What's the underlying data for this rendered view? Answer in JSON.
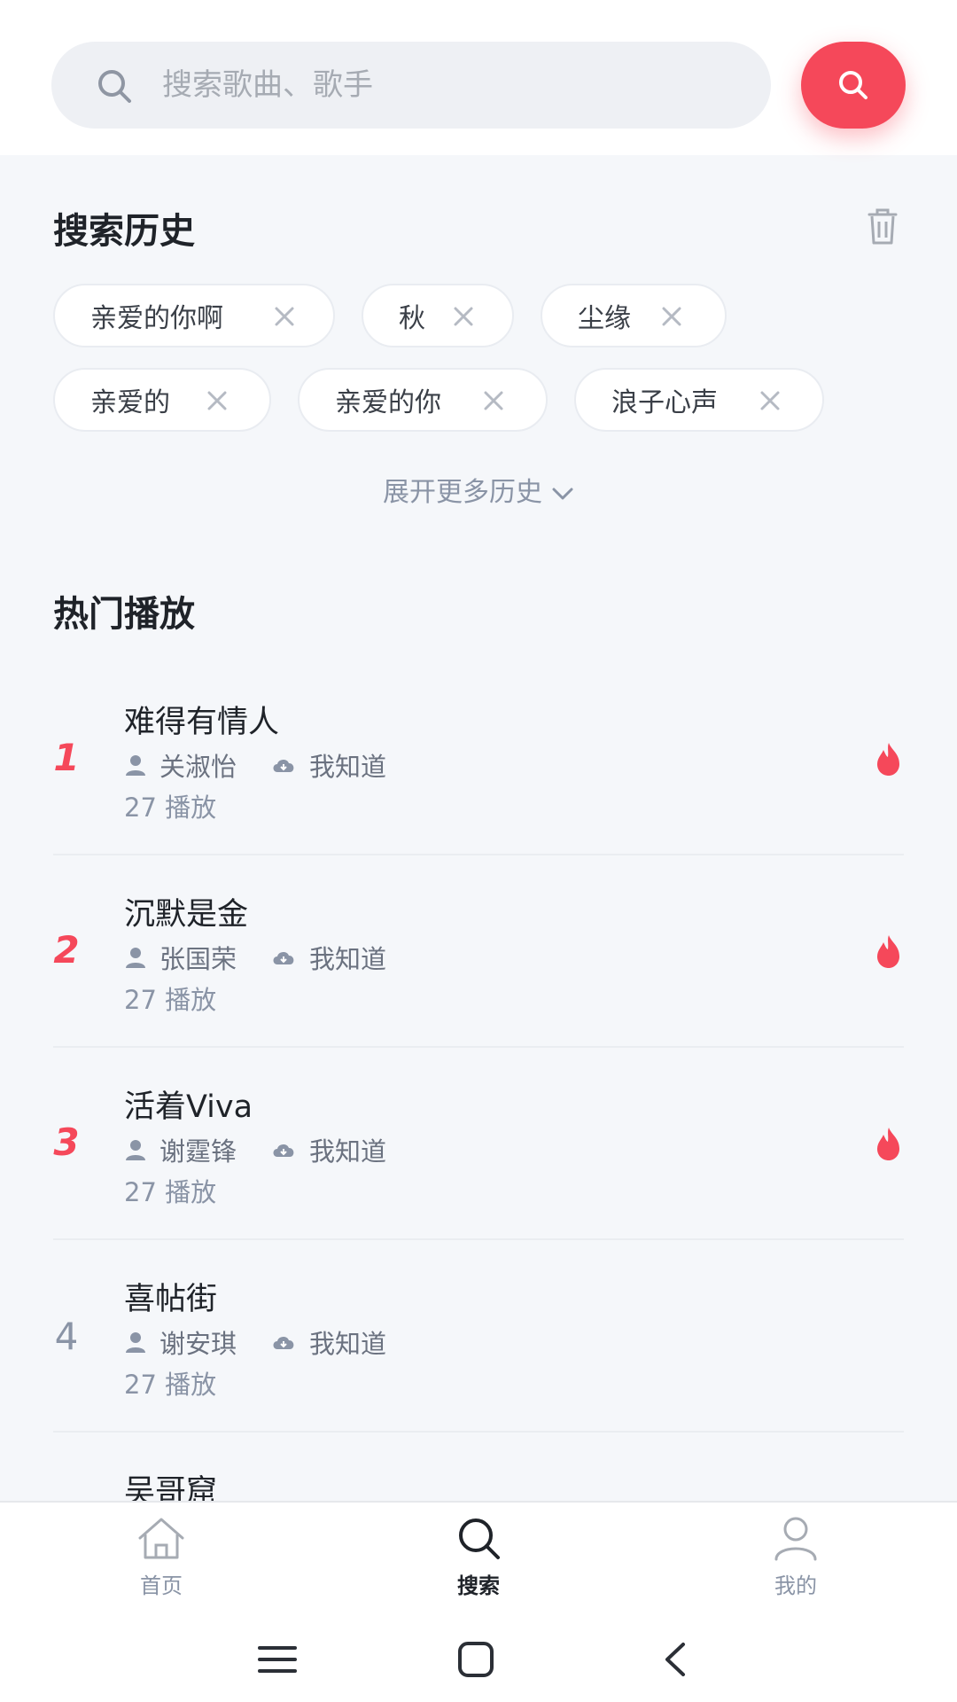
{
  "search": {
    "placeholder": "搜索歌曲、歌手"
  },
  "history": {
    "title": "搜索历史",
    "chips": [
      "亲爱的你啊",
      "秋",
      "尘缘",
      "亲爱的",
      "亲爱的你",
      "浪子心声"
    ],
    "more_label": "展开更多历史"
  },
  "hot": {
    "title": "热门播放",
    "items": [
      {
        "rank": "1",
        "title": "难得有情人",
        "artist": "关淑怡",
        "source": "我知道",
        "plays": "27 播放"
      },
      {
        "rank": "2",
        "title": "沉默是金",
        "artist": "张国荣",
        "source": "我知道",
        "plays": "27 播放"
      },
      {
        "rank": "3",
        "title": "活着Viva",
        "artist": "谢霆锋",
        "source": "我知道",
        "plays": "27 播放"
      },
      {
        "rank": "4",
        "title": "喜帖街",
        "artist": "谢安琪",
        "source": "我知道",
        "plays": "27 播放"
      },
      {
        "rank": "",
        "title": "吴哥窟",
        "artist": "",
        "source": "",
        "plays": ""
      }
    ]
  },
  "tabbar": {
    "home": "首页",
    "search": "搜索",
    "mine": "我的"
  },
  "colors": {
    "accent": "#f5485a",
    "muted": "#8a94a6"
  },
  "icons": [
    "search-icon",
    "trash-icon",
    "close-icon",
    "chevron-down-icon",
    "user-icon",
    "cloud-icon",
    "fire-icon",
    "home-icon",
    "menu-icon",
    "square-icon",
    "back-icon"
  ]
}
